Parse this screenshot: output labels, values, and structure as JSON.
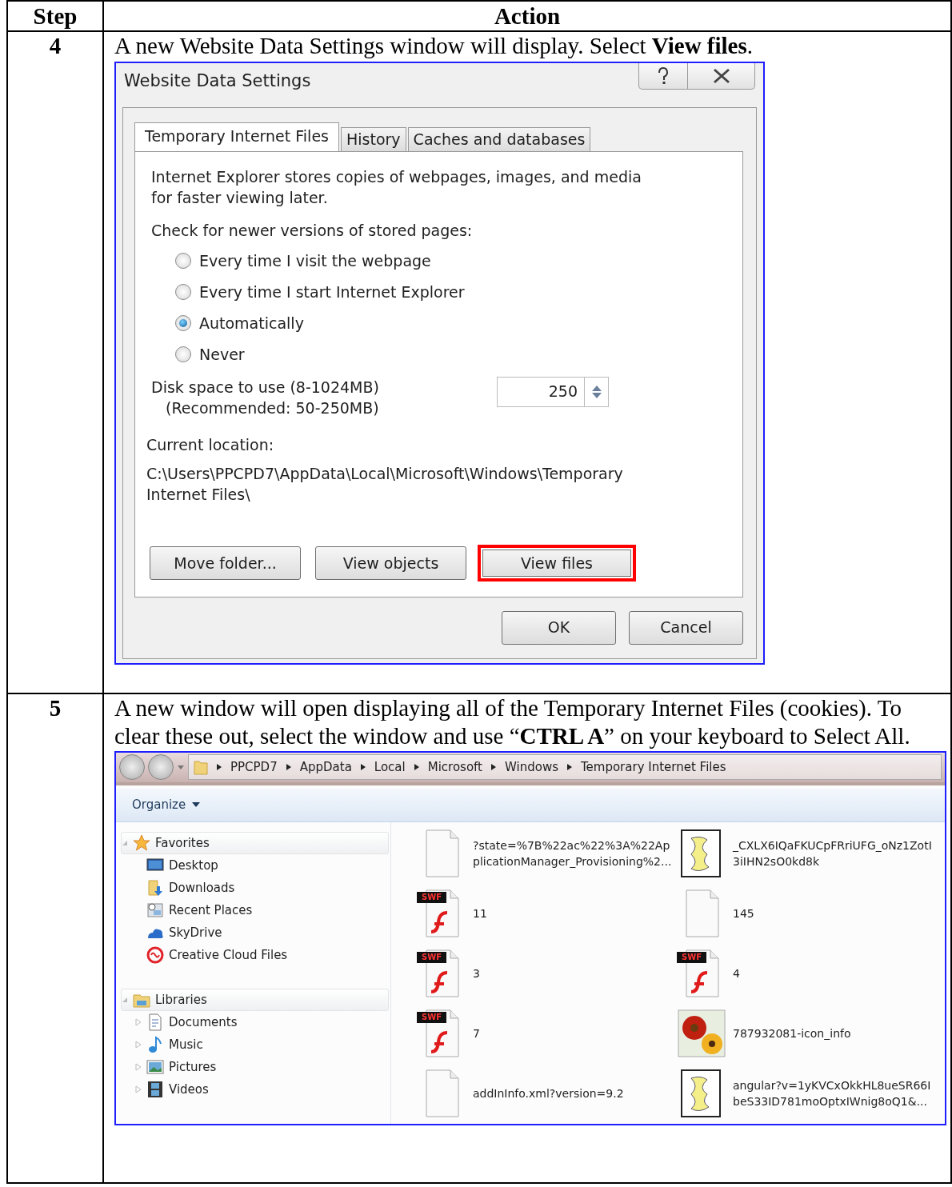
{
  "table": {
    "columns": [
      "Step",
      "Action"
    ]
  },
  "steps": [
    {
      "number": "4",
      "instruction": "A new Website Data Settings window will display. Select **View files**.",
      "dialog": {
        "title": "Website Data Settings",
        "tabs": [
          {
            "label": "Temporary Internet Files",
            "selected": true
          },
          {
            "label": "History",
            "selected": false
          },
          {
            "label": "Caches and databases",
            "selected": false
          }
        ],
        "description": "Internet Explorer stores copies of webpages, images, and media for faster viewing later.",
        "check_label": "Check for newer versions of stored pages:",
        "options": [
          {
            "label": "Every time I visit the webpage",
            "selected": false
          },
          {
            "label": "Every time I start Internet Explorer",
            "selected": false
          },
          {
            "label": "Automatically",
            "selected": true
          },
          {
            "label": "Never",
            "selected": false
          }
        ],
        "disk_space_label": "Disk space to use (8-1024MB)",
        "disk_space_hint": "(Recommended: 50-250MB)",
        "disk_space_value": "250",
        "location_label": "Current location:",
        "location_path": "C:\\Users\\PPCPD7\\AppData\\Local\\Microsoft\\Windows\\Temporary Internet Files\\",
        "buttons": [
          {
            "label": "Move folder...",
            "highlighted": false
          },
          {
            "label": "View objects",
            "highlighted": false
          },
          {
            "label": "View files",
            "highlighted": true
          }
        ],
        "footer_buttons": [
          "OK",
          "Cancel"
        ]
      }
    },
    {
      "number": "5",
      "instruction": "A new window will open displaying all of the Temporary Internet Files (cookies). To clear these out, select the window and use “**CTRL A**” on your keyboard to Select All.",
      "explorer": {
        "breadcrumb": [
          "PPCPD7",
          "AppData",
          "Local",
          "Microsoft",
          "Windows",
          "Temporary Internet Files"
        ],
        "toolbar": [
          "Organize"
        ],
        "nav": [
          {
            "label": "Favorites",
            "expanded": true,
            "children": [
              {
                "label": "Desktop"
              },
              {
                "label": "Downloads"
              },
              {
                "label": "Recent Places"
              },
              {
                "label": "SkyDrive"
              },
              {
                "label": "Creative Cloud Files"
              }
            ]
          },
          {
            "label": "Libraries",
            "expanded": true,
            "children": [
              {
                "label": "Documents",
                "expanded": false
              },
              {
                "label": "Music",
                "expanded": false
              },
              {
                "label": "Pictures",
                "expanded": false
              },
              {
                "label": "Videos",
                "expanded": false
              }
            ]
          }
        ],
        "files": [
          {
            "kind": "blank",
            "name": "?state=%7B%22ac%22%3A%22ApplicationManager_Provisioning%2..."
          },
          {
            "kind": "script",
            "name": "_CXLX6IQaFKUCpFRriUFG_oNz1ZotI3iIHN2sO0kd8k"
          },
          {
            "kind": "swf",
            "badge": "SWF",
            "name": "11"
          },
          {
            "kind": "blank",
            "name": "145"
          },
          {
            "kind": "swf",
            "badge": "SWF",
            "name": "3"
          },
          {
            "kind": "swf",
            "badge": "SWF",
            "name": "4"
          },
          {
            "kind": "swf",
            "badge": "SWF",
            "name": "7"
          },
          {
            "kind": "image",
            "name": "787932081-icon_info"
          },
          {
            "kind": "blank",
            "name": "addInInfo.xml?version=9.2"
          },
          {
            "kind": "script",
            "name": "angular?v=1yKVCxOkkHL8ueSR66IbeS33ID781moOptxIWnig8oQ1&..."
          }
        ]
      }
    }
  ]
}
